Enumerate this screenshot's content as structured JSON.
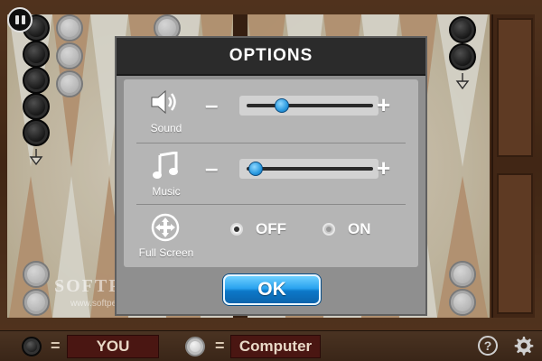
{
  "dialog": {
    "title": "OPTIONS",
    "sound": {
      "label": "Sound",
      "minus": "–",
      "plus": "+",
      "level": 0.28
    },
    "music": {
      "label": "Music",
      "minus": "–",
      "plus": "+",
      "level": 0.07
    },
    "fullscreen": {
      "label": "Full Screen",
      "off_label": "OFF",
      "on_label": "ON",
      "selected": "OFF"
    },
    "ok_label": "OK"
  },
  "players": {
    "human": {
      "name": "YOU",
      "checker_color": "black"
    },
    "computer": {
      "name": "Computer",
      "checker_color": "white"
    },
    "equals": "="
  },
  "controls": {
    "help": "?"
  },
  "watermark": {
    "main": "SOFTPEDIA",
    "tm": "™",
    "url": "www.softpedia.com"
  },
  "colors": {
    "accent": "#2a9ae0",
    "name_box": "#4a1612",
    "dialog_header": "#2b2b2b"
  }
}
